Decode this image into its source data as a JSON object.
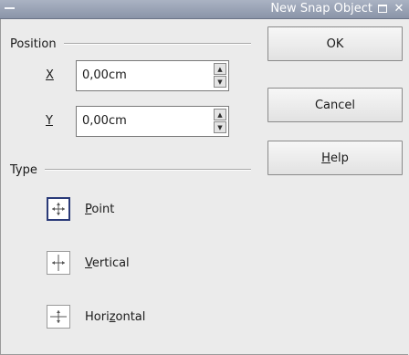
{
  "window": {
    "title": "New Snap Object"
  },
  "position": {
    "header": "Position",
    "x": {
      "label": "X",
      "value": "0,00cm"
    },
    "y": {
      "label": "Y",
      "value": "0,00cm"
    }
  },
  "type": {
    "header": "Type",
    "options": [
      {
        "label_mnemonic": "P",
        "label_rest": "oint",
        "selected": true,
        "icon": "snap-point-icon"
      },
      {
        "label_mnemonic": "V",
        "label_rest": "ertical",
        "selected": false,
        "icon": "snap-vertical-line-icon"
      },
      {
        "label_before": "Hori",
        "label_mnemonic": "z",
        "label_rest": "ontal",
        "selected": false,
        "icon": "snap-horizontal-line-icon"
      }
    ]
  },
  "buttons": {
    "ok": "OK",
    "cancel": "Cancel",
    "help_mnemonic": "H",
    "help_rest": "elp"
  },
  "colors": {
    "titlebar": "#9aa3b5",
    "dialog_bg": "#ebebeb",
    "selection_border": "#2a3a78"
  }
}
